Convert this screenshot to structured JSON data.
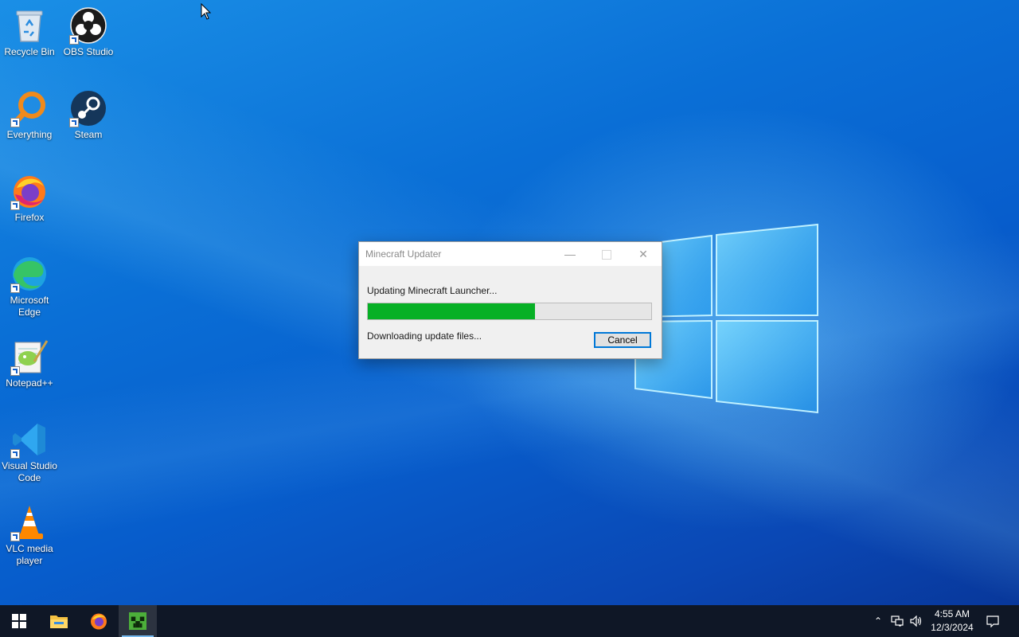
{
  "desktop": {
    "icons": [
      {
        "label": "Recycle Bin"
      },
      {
        "label": "OBS Studio"
      },
      {
        "label": "Everything"
      },
      {
        "label": "Steam"
      },
      {
        "label": "Firefox"
      },
      {
        "label": "Microsoft Edge"
      },
      {
        "label": "Notepad++"
      },
      {
        "label": "Visual Studio Code"
      },
      {
        "label": "VLC media player"
      }
    ]
  },
  "dialog": {
    "title": "Minecraft Updater",
    "status": "Updating Minecraft Launcher...",
    "progress_percent": 59,
    "detail": "Downloading update files...",
    "cancel_label": "Cancel",
    "progress_color": "#06b025"
  },
  "taskbar": {
    "items": [
      "start-icon",
      "file-explorer-icon",
      "firefox-icon",
      "minecraft-icon"
    ],
    "active_item": "minecraft-icon",
    "time": "4:55 AM",
    "date": "12/3/2024"
  }
}
